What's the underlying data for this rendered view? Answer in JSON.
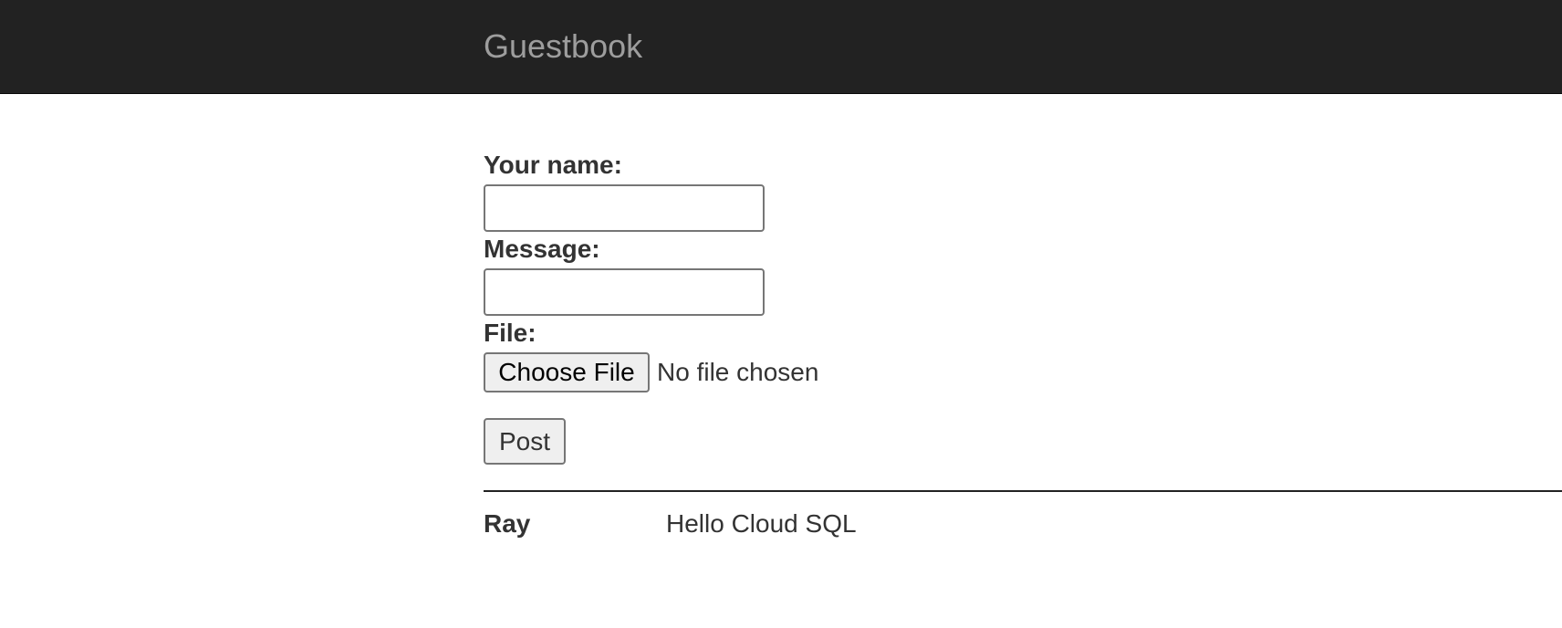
{
  "navbar": {
    "brand": "Guestbook"
  },
  "form": {
    "name_label": "Your name:",
    "name_value": "",
    "message_label": "Message:",
    "message_value": "",
    "file_label": "File:",
    "file_button_label": "Choose File",
    "file_status": "No file chosen",
    "submit_label": "Post"
  },
  "entries": [
    {
      "name": "Ray",
      "message": "Hello Cloud SQL"
    }
  ],
  "colors": {
    "navbar_bg": "#222222",
    "brand_text": "#9d9d9d",
    "body_text": "#333333"
  }
}
